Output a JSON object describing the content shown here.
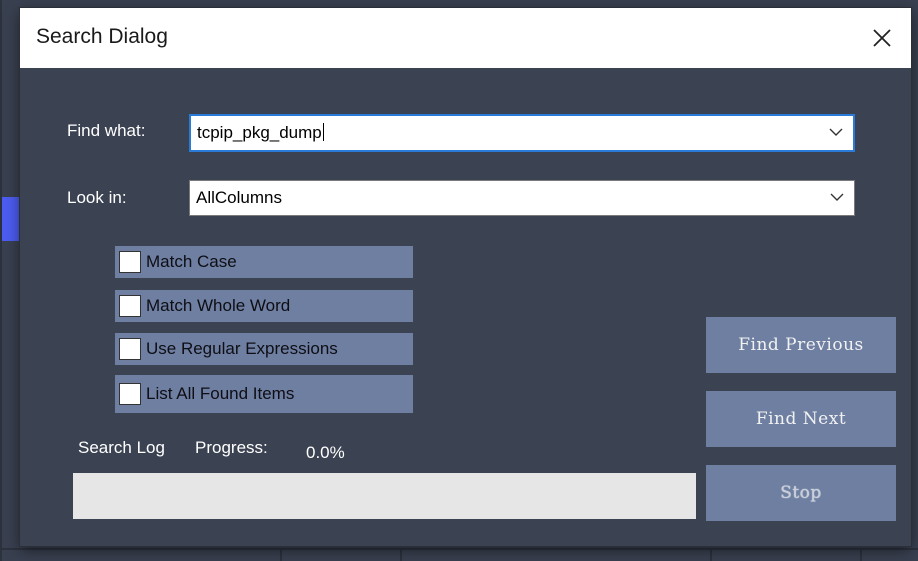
{
  "dialog": {
    "title": "Search Dialog"
  },
  "find": {
    "label": "Find what:",
    "value": "tcpip_pkg_dump"
  },
  "look_in": {
    "label": "Look in:",
    "value": "AllColumns"
  },
  "options": [
    {
      "label": "Match Case",
      "checked": false
    },
    {
      "label": "Match Whole Word",
      "checked": false
    },
    {
      "label": "Use Regular Expressions",
      "checked": false
    },
    {
      "label": "List All Found Items",
      "checked": false
    }
  ],
  "buttons": {
    "find_previous": "Find Previous",
    "find_next": "Find Next",
    "stop": "Stop"
  },
  "progress": {
    "log_label": "Search Log",
    "label": "Progress:",
    "value_text": "0.0%",
    "fraction": 0.0
  },
  "colors": {
    "accent": "#2a7ad8",
    "button_bg": "#6e7fa2",
    "dialog_bg": "#3b4252"
  },
  "icons": {
    "close": "close-icon",
    "dropdown": "chevron-down-icon"
  }
}
